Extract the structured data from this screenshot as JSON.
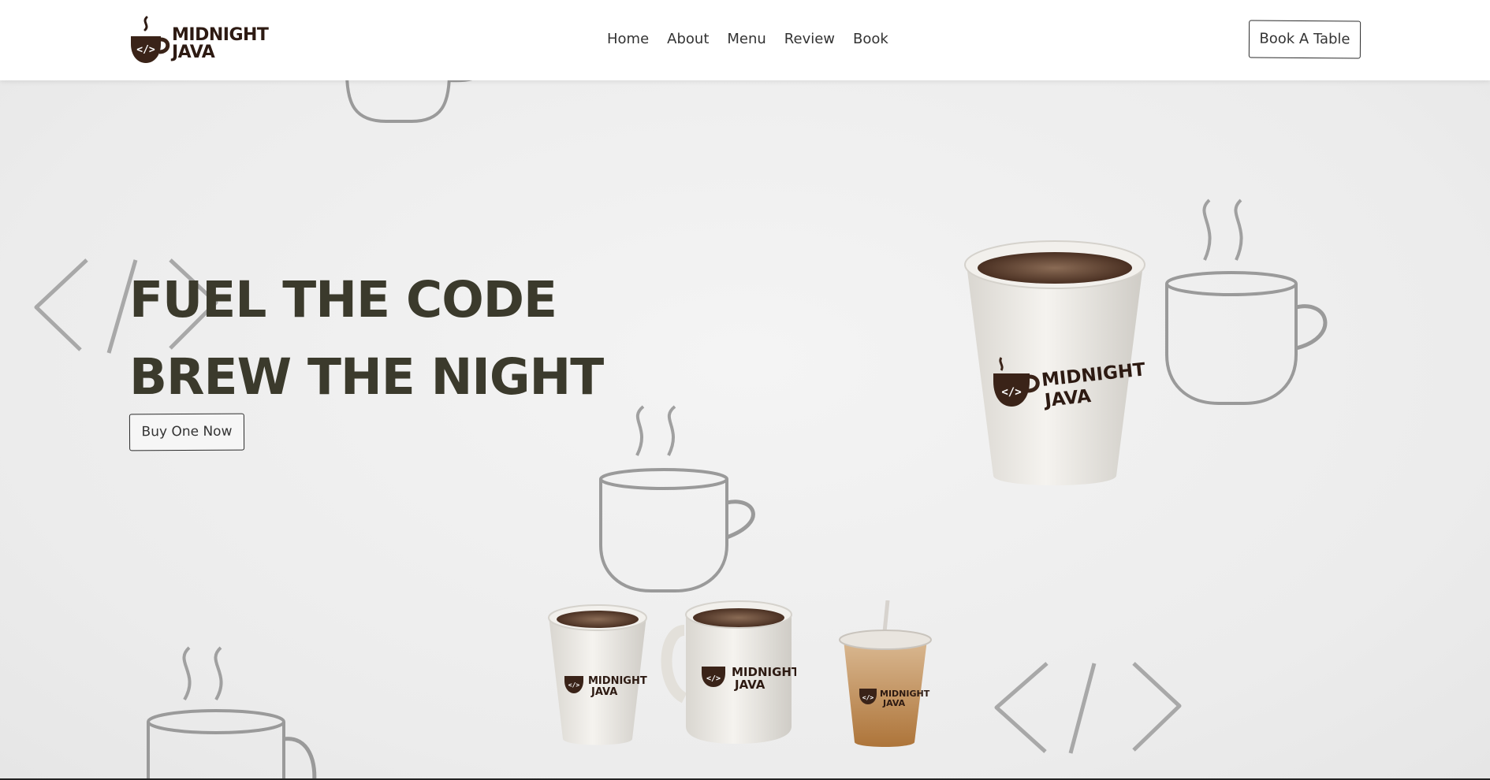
{
  "brand": {
    "logo_line1": "MIDNIGHT",
    "logo_line2": "JAVA",
    "logo_icon": "coffee-cup-code-icon",
    "brand_color": "#2d1a12"
  },
  "nav": {
    "items": [
      {
        "label": "Home"
      },
      {
        "label": "About"
      },
      {
        "label": "Menu"
      },
      {
        "label": "Review"
      },
      {
        "label": "Book"
      }
    ],
    "cta_label": "Book A Table"
  },
  "hero": {
    "headline_line1": "FUEL THE CODE",
    "headline_line2": "BREW THE NIGHT",
    "cta_label": "Buy One Now",
    "headline_color": "#3b3a2c"
  },
  "products": {
    "cup_logo_line1": "MIDNIGHT",
    "cup_logo_line2": "JAVA"
  }
}
